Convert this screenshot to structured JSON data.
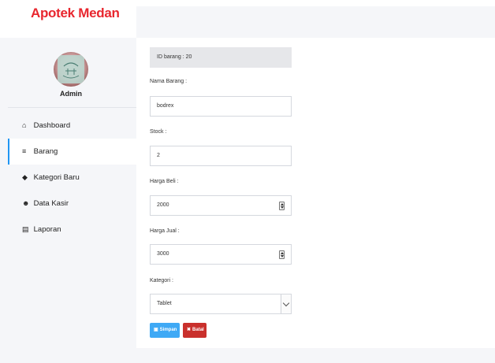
{
  "app": {
    "title": "Apotek Medan"
  },
  "user": {
    "name": "Admin"
  },
  "sidebar": {
    "items": [
      {
        "label": "Dashboard",
        "icon": "home-icon",
        "glyph": "⌂",
        "active": false
      },
      {
        "label": "Barang",
        "icon": "bars-icon",
        "glyph": "≡",
        "active": true
      },
      {
        "label": "Kategori Baru",
        "icon": "tag-icon",
        "glyph": "◆",
        "active": false
      },
      {
        "label": "Data Kasir",
        "icon": "users-icon",
        "glyph": "☻",
        "active": false
      },
      {
        "label": "Laporan",
        "icon": "book-icon",
        "glyph": "▤",
        "active": false
      }
    ]
  },
  "form": {
    "id_field": "ID barang : 20",
    "nama": {
      "label": "Nama Barang :",
      "value": "bodrex"
    },
    "stock": {
      "label": "Stock :",
      "value": "2"
    },
    "harga_beli": {
      "label": "Harga Beli :",
      "value": "2000"
    },
    "harga_jual": {
      "label": "Harga Jual :",
      "value": "3000"
    },
    "kategori": {
      "label": "Kategori :",
      "value": "Tablet"
    },
    "save_label": "Simpan",
    "cancel_label": "Batal"
  },
  "colors": {
    "brand": "#e8262e",
    "active_accent": "#2196f3",
    "save": "#3fa9f5",
    "cancel": "#c9302c"
  }
}
